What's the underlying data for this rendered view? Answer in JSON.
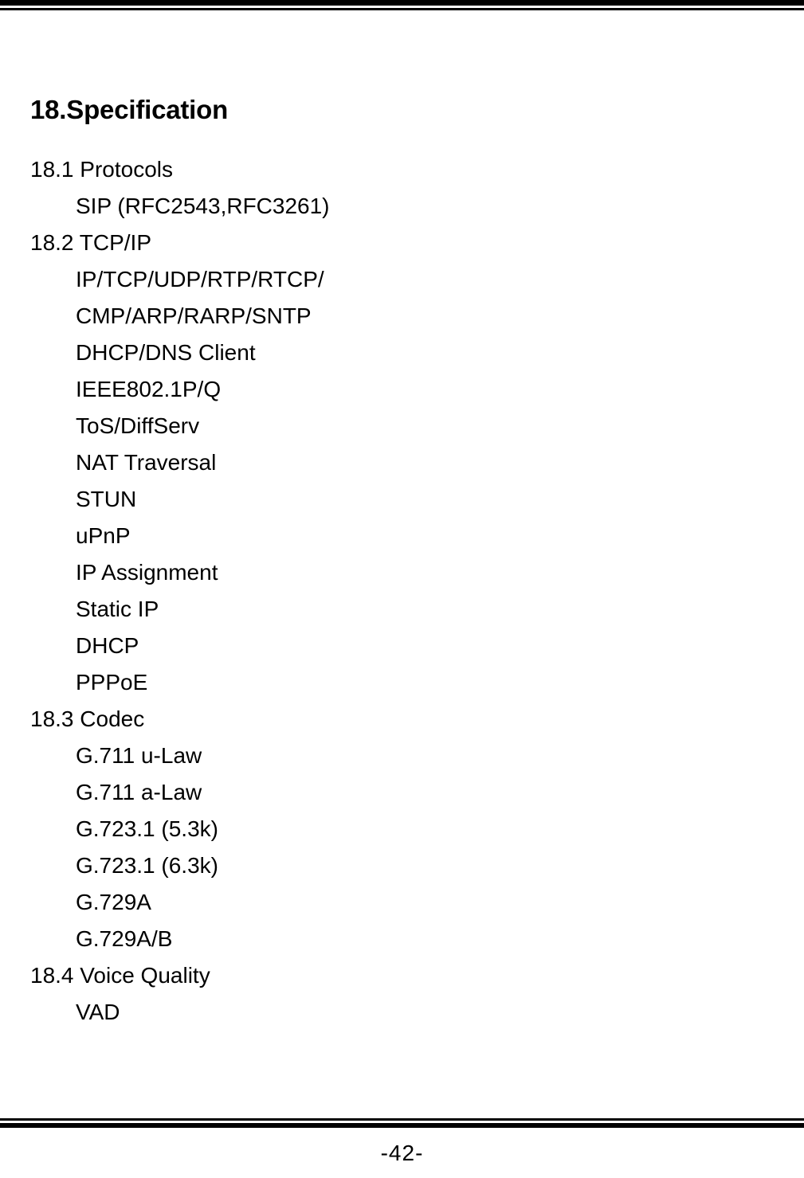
{
  "document": {
    "title": "18.Specification",
    "page_number": "-42-"
  },
  "lines": [
    {
      "level": "section",
      "text": "18.1 Protocols"
    },
    {
      "level": "item",
      "text": "SIP (RFC2543,RFC3261)"
    },
    {
      "level": "section",
      "text": "18.2 TCP/IP"
    },
    {
      "level": "item",
      "text": "IP/TCP/UDP/RTP/RTCP/"
    },
    {
      "level": "item",
      "text": "CMP/ARP/RARP/SNTP"
    },
    {
      "level": "item",
      "text": "DHCP/DNS Client"
    },
    {
      "level": "item",
      "text": "IEEE802.1P/Q"
    },
    {
      "level": "item",
      "text": "ToS/DiffServ"
    },
    {
      "level": "item",
      "text": "NAT Traversal"
    },
    {
      "level": "item",
      "text": "STUN"
    },
    {
      "level": "item",
      "text": "uPnP"
    },
    {
      "level": "item",
      "text": "IP Assignment"
    },
    {
      "level": "item",
      "text": "Static IP"
    },
    {
      "level": "item",
      "text": "DHCP"
    },
    {
      "level": "item",
      "text": "PPPoE"
    },
    {
      "level": "section",
      "text": "18.3 Codec"
    },
    {
      "level": "item",
      "text": "G.711 u-Law"
    },
    {
      "level": "item",
      "text": "G.711 a-Law"
    },
    {
      "level": "item",
      "text": "G.723.1 (5.3k)"
    },
    {
      "level": "item",
      "text": "G.723.1 (6.3k)"
    },
    {
      "level": "item",
      "text": "G.729A"
    },
    {
      "level": "item",
      "text": "G.729A/B"
    },
    {
      "level": "section",
      "text": "18.4 Voice Quality"
    },
    {
      "level": "item",
      "text": "VAD"
    }
  ]
}
